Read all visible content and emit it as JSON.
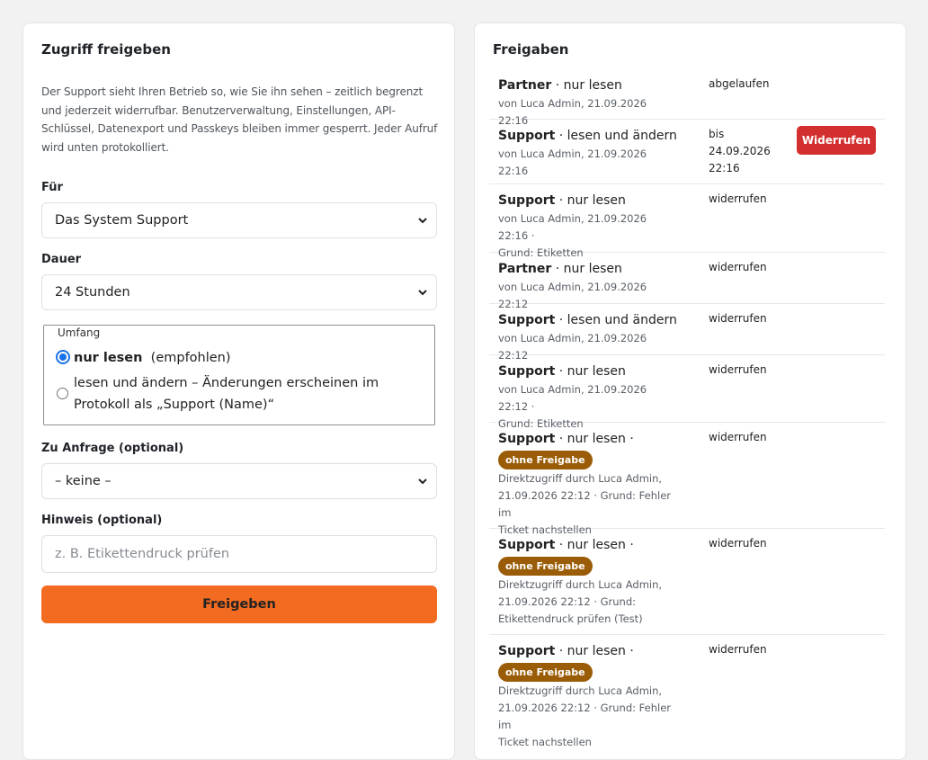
{
  "left": {
    "title": "Zugriff freigeben",
    "intro": "Der Support sieht Ihren Betrieb so, wie Sie ihn sehen – zeitlich begrenzt und jederzeit widerrufbar. Benutzerverwaltung, Einstellungen, API-Schlüssel, Datenexport und Passkeys bleiben immer gesperrt. Jeder Aufruf wird unten protokolliert.",
    "for_label": "Für",
    "for_value": "Das System Support",
    "duration_label": "Dauer",
    "duration_value": "24 Stunden",
    "scope_legend": "Umfang",
    "scope_opt1_strong": "nur lesen",
    "scope_opt1_rest": "(empfohlen)",
    "scope_opt2_line1": "lesen und ändern – Änderungen erscheinen im",
    "scope_opt2_line2": "Protokoll als „Support (Name)“",
    "request_label": "Zu Anfrage (optional)",
    "request_value": "– keine –",
    "note_label": "Hinweis (optional)",
    "note_placeholder": "z. B. Etikettendruck prüfen",
    "submit_label": "Freigeben"
  },
  "right": {
    "title": "Freigaben",
    "revoke_label": "Widerrufen",
    "entries": [
      {
        "who": "Partner",
        "mode": "nur lesen",
        "meta1": "von Luca Admin, 21.09.2026 22:16",
        "status": "abgelaufen"
      },
      {
        "who": "Support",
        "mode": "lesen und ändern",
        "meta1": "von Luca Admin, 21.09.2026 22:16",
        "status1": "bis",
        "status2": "24.09.2026",
        "status3": "22:16"
      },
      {
        "who": "Support",
        "mode": "nur lesen",
        "meta1": "von Luca Admin, 21.09.2026 22:16 ·",
        "meta2": "Grund: Etiketten",
        "status": "widerrufen"
      },
      {
        "who": "Partner",
        "mode": "nur lesen",
        "meta1": "von Luca Admin, 21.09.2026 22:12",
        "status": "widerrufen"
      },
      {
        "who": "Support",
        "mode": "lesen und ändern",
        "meta1": "von Luca Admin, 21.09.2026 22:12",
        "status": "widerrufen"
      },
      {
        "who": "Support",
        "mode": "nur lesen",
        "meta1": "von Luca Admin, 21.09.2026 22:12 ·",
        "meta2": "Grund: Etiketten",
        "status": "widerrufen"
      },
      {
        "who": "Support",
        "mode": "nur lesen ·",
        "badge": "ohne Freigabe",
        "meta1": "Direktzugriff durch Luca Admin,",
        "meta2": "21.09.2026 22:12 · Grund: Fehler im",
        "meta3": "Ticket nachstellen",
        "status": "widerrufen"
      },
      {
        "who": "Support",
        "mode": "nur lesen ·",
        "badge": "ohne Freigabe",
        "meta1": "Direktzugriff durch Luca Admin,",
        "meta2": "21.09.2026 22:12 · Grund:",
        "meta3": "Etikettendruck prüfen (Test)",
        "status": "widerrufen"
      },
      {
        "who": "Support",
        "mode": "nur lesen ·",
        "badge": "ohne Freigabe",
        "meta1": "Direktzugriff durch Luca Admin,",
        "meta2": "21.09.2026 22:12 · Grund: Fehler im",
        "meta3": "Ticket nachstellen",
        "status": "widerrufen"
      }
    ]
  },
  "colors": {
    "accent": "#f26b21",
    "danger": "#d32f2f",
    "badge": "#9a5c06",
    "radio": "#1a73e8"
  },
  "icons": {
    "select_chevron": "chevron-down-icon"
  }
}
